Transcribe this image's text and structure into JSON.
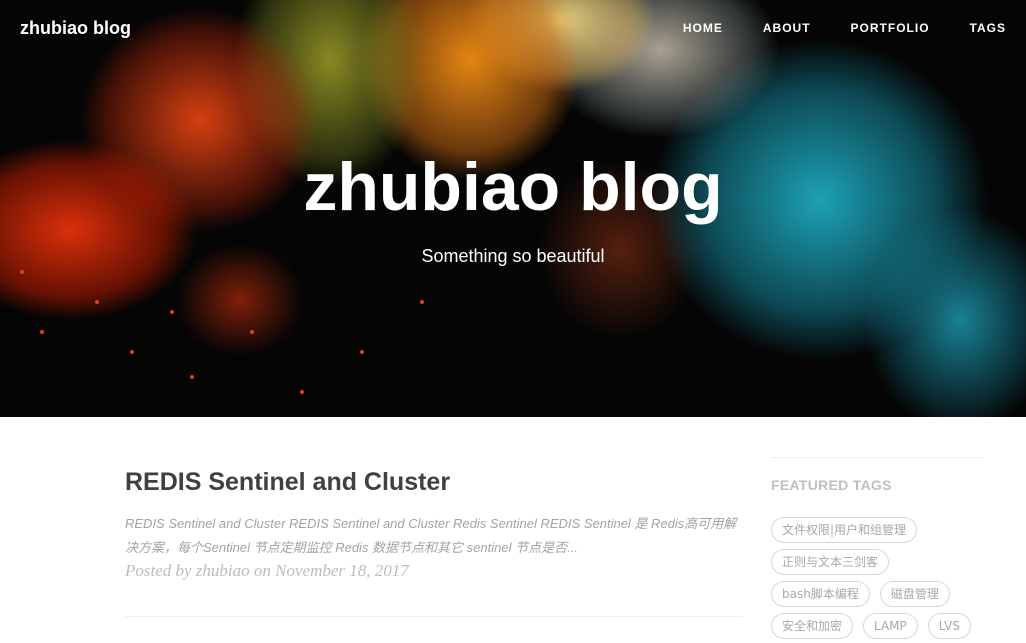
{
  "site": {
    "brand": "zhubiao blog",
    "nav": [
      "HOME",
      "ABOUT",
      "PORTFOLIO",
      "TAGS"
    ]
  },
  "hero": {
    "title": "zhubiao blog",
    "subtitle": "Something so beautiful"
  },
  "post": {
    "title": "REDIS Sentinel and Cluster",
    "excerpt": "REDIS Sentinel and Cluster REDIS Sentinel and Cluster Redis Sentinel REDIS Sentinel 是 Redis高可用解决方案，每个Sentinel 节点定期监控 Redis 数据节点和其它 sentinel 节点是否...",
    "meta": "Posted by zhubiao on November 18, 2017"
  },
  "sidebar": {
    "heading": "FEATURED TAGS",
    "tags": [
      "文件权限|用户和组管理",
      "正则与文本三剑客",
      "bash脚本编程",
      "磁盘管理",
      "安全和加密",
      "LAMP",
      "LVS"
    ]
  },
  "colors": {
    "text": "#404040",
    "muted": "#a3a3a3",
    "meta": "#bcbcbc",
    "tag_border": "#d8d8d8"
  }
}
